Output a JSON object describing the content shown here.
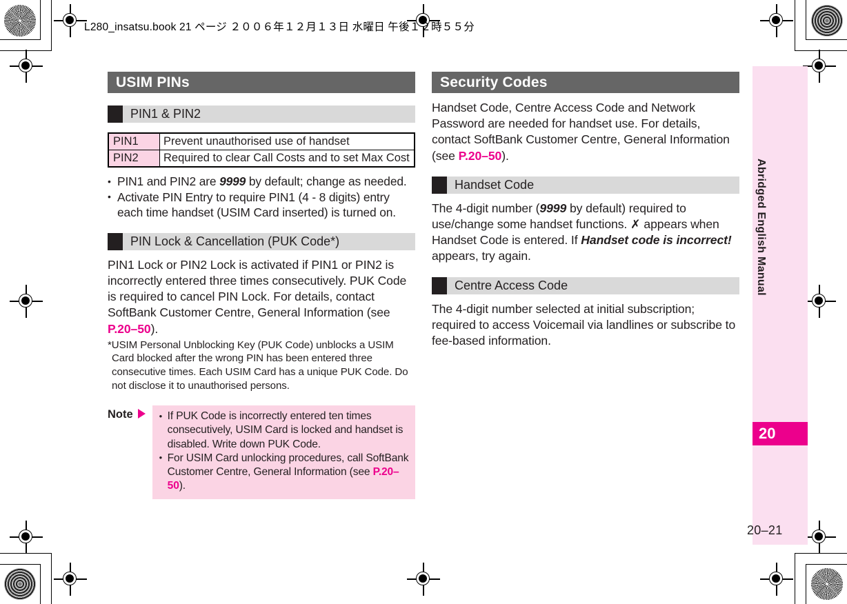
{
  "running_head": "L280_insatsu.book  21 ページ  ２００６年１２月１３日   水曜日   午後１２時５５分",
  "left_column": {
    "section_title": "USIM PINs",
    "subsection_1": "PIN1 & PIN2",
    "table": {
      "rows": [
        {
          "key": "PIN1",
          "value": "Prevent unauthorised use of handset"
        },
        {
          "key": "PIN2",
          "value": "Required to clear Call Costs and to set Max Cost"
        }
      ]
    },
    "bullets": [
      {
        "part1": "PIN1 and PIN2 are ",
        "emphasis": "9999",
        "part2": " by default; change as needed."
      },
      {
        "part1": "Activate PIN Entry to require PIN1 (4 - 8 digits) entry each time handset (USIM Card inserted) is turned on.",
        "emphasis": "",
        "part2": ""
      }
    ],
    "subsection_2": "PIN Lock & Cancellation (PUK Code*)",
    "paragraph_lead": "PIN1 Lock or PIN2 Lock is activated if PIN1 or PIN2 is incorrectly entered three times consecutively. PUK Code is required to cancel PIN Lock. For details, contact SoftBank Customer Centre, General Information (see ",
    "paragraph_ref": "P.20–50",
    "paragraph_tail": ").",
    "footnote": "*USIM Personal Unblocking Key (PUK Code) unblocks a USIM Card blocked after the wrong PIN has been entered three consecutive times. Each USIM Card has a unique PUK Code. Do not disclose it to unauthorised persons.",
    "note": {
      "label": "Note",
      "items": [
        {
          "text": "If PUK Code is incorrectly entered ten times consecutively, USIM Card is locked and handset is disabled. Write down PUK Code.",
          "ref": "",
          "tail": ""
        },
        {
          "text": "For USIM Card unlocking procedures, call SoftBank Customer Centre, General Information (see ",
          "ref": "P.20–50",
          "tail": ")."
        }
      ]
    }
  },
  "right_column": {
    "section_title": "Security Codes",
    "intro_lead": "Handset Code, Centre Access Code and Network Password are needed for handset use. For details, contact SoftBank Customer Centre, General Information (see ",
    "intro_ref": "P.20–50",
    "intro_tail": ").",
    "subsection_1": "Handset Code",
    "handset_code": {
      "lead": "The 4-digit number (",
      "default_value": "9999",
      "mid1": " by default) required to use/change some handset functions. ",
      "symbol": "✗",
      "mid2": " appears when Handset Code is entered. If ",
      "message": "Handset code is incorrect!",
      "tail": " appears, try again."
    },
    "subsection_2": "Centre Access Code",
    "centre_access_code": "The 4-digit number selected at initial subscription; required to access Voicemail via landlines or subscribe to fee-based information."
  },
  "thumb_tab": {
    "label": "Abridged English Manual",
    "number": "20"
  },
  "folio": "20–21",
  "colors": {
    "section_bar": "#666666",
    "sub_bar": "#d9d9d9",
    "sub_square": "#231f20",
    "accent_magenta": "#ec008c",
    "pink_fill": "#fbd4e4",
    "thumb_pink": "#fbdff0"
  }
}
